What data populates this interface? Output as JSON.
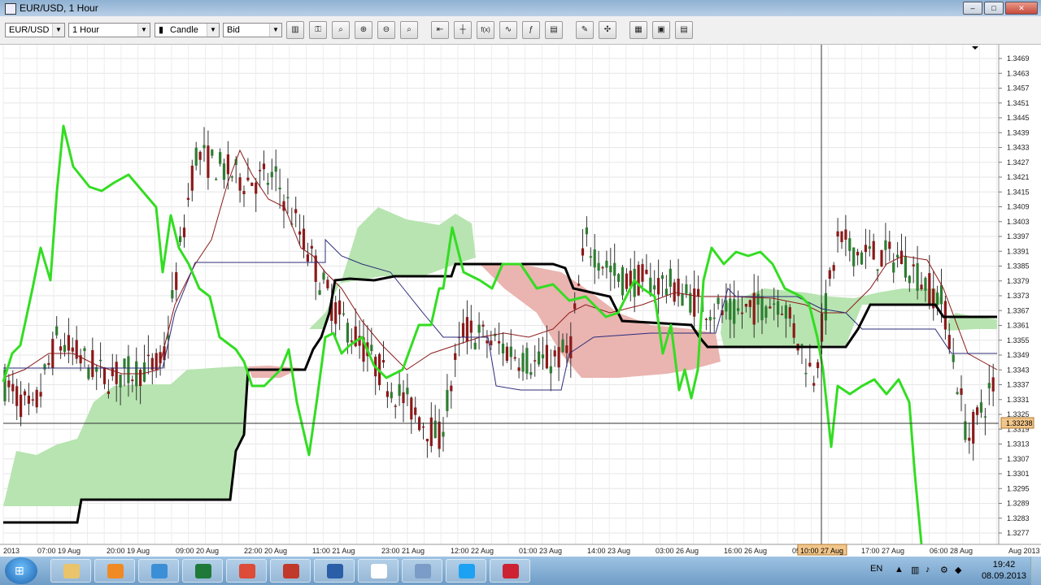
{
  "window": {
    "title": "EUR/USD, 1 Hour",
    "buttons": [
      "minimize",
      "maximize",
      "close"
    ]
  },
  "toolbar": {
    "instrument": "EUR/USD",
    "period": "1 Hour",
    "chart_type": "Candle",
    "price_type": "Bid",
    "tools": [
      {
        "name": "bar-chart-icon",
        "glyph": "▥"
      },
      {
        "name": "lock-icon",
        "glyph": "⚿"
      },
      {
        "name": "zoom-icon",
        "glyph": "⌕"
      },
      {
        "name": "zoom-in-icon",
        "glyph": "⊕"
      },
      {
        "name": "zoom-out-icon",
        "glyph": "⊖"
      },
      {
        "name": "zoom-reset-icon",
        "glyph": "⌕"
      },
      {
        "name": "shift-chart-icon",
        "glyph": "⇤"
      },
      {
        "name": "crosshair-icon",
        "glyph": "┼"
      },
      {
        "name": "indicators-icon",
        "glyph": "f(x)"
      },
      {
        "name": "studies-icon",
        "glyph": "∿"
      },
      {
        "name": "custom-indicator-icon",
        "glyph": "ƒ"
      },
      {
        "name": "templates-icon",
        "glyph": "▤"
      },
      {
        "name": "pencil-draw-icon",
        "glyph": "✎"
      },
      {
        "name": "objects-icon",
        "glyph": "✣"
      },
      {
        "name": "grid-icon",
        "glyph": "▦"
      },
      {
        "name": "save-icon",
        "glyph": "▣"
      },
      {
        "name": "table-icon",
        "glyph": "▤"
      }
    ]
  },
  "chart": {
    "price_ticks": [
      "1.3469",
      "1.3463",
      "1.3457",
      "1.3451",
      "1.3445",
      "1.3439",
      "1.3433",
      "1.3427",
      "1.3421",
      "1.3415",
      "1.3409",
      "1.3403",
      "1.3397",
      "1.3391",
      "1.3385",
      "1.3379",
      "1.3373",
      "1.3367",
      "1.3361",
      "1.3355",
      "1.3349",
      "1.3343",
      "1.3337",
      "1.3331",
      "1.3325",
      "1.3319",
      "1.3313",
      "1.3307",
      "1.3301",
      "1.3295",
      "1.3289",
      "1.3283",
      "1.3277"
    ],
    "current_price": "1.33238",
    "crosshair_time": "10:00 27 Aug",
    "time_ticks": [
      "2013",
      "07:00 19 Aug",
      "20:00 19 Aug",
      "09:00 20 Aug",
      "22:00 20 Aug",
      "11:00 21 Aug",
      "23:00 21 Aug",
      "12:00 22 Aug",
      "01:00 23 Aug",
      "14:00 23 Aug",
      "03:00 26 Aug",
      "16:00 26 Aug",
      "05:00 27 Aug",
      "17:00 27 Aug",
      "06:00 28 Aug",
      "Aug 2013"
    ],
    "colors": {
      "bull": "#2e7d32",
      "bear": "#8b1a1a",
      "chikou": "#33dd22",
      "kijun": "#000000",
      "tenkan": "#8b1a1a",
      "cloud_up": "#b7e4b0",
      "cloud_down": "#eab4b0"
    }
  },
  "taskbar": {
    "items": [
      "windows-explorer",
      "media-player",
      "internet-explorer",
      "trading-app",
      "chrome",
      "paint",
      "word",
      "blank-window",
      "image-viewer",
      "skype",
      "opera"
    ],
    "language": "EN",
    "time": "19:42",
    "date": "08.09.2013"
  }
}
